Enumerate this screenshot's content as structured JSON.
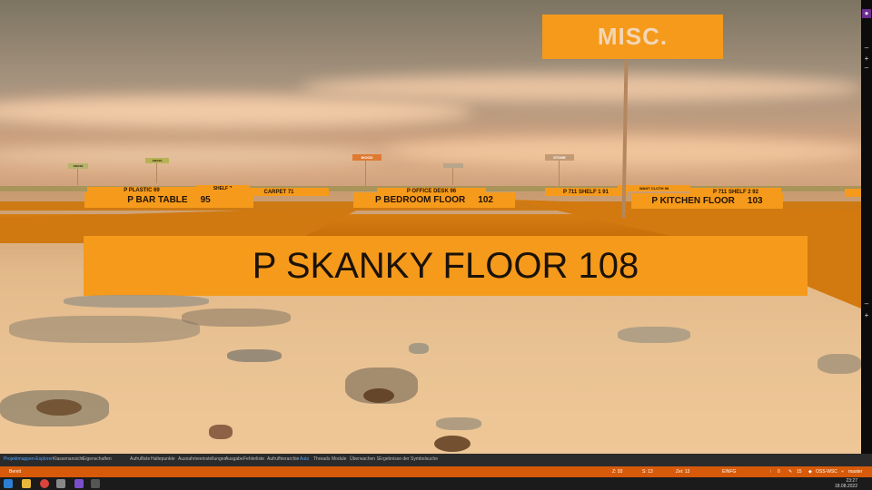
{
  "world": {
    "misc_sign": "MISC.",
    "main_sign": "P SKANKY FLOOR 108",
    "near_signs": [
      {
        "label": "P BAR TABLE",
        "number": "95"
      },
      {
        "label": "P BEDROOM FLOOR",
        "number": "102"
      },
      {
        "label": "P KITCHEN FLOOR",
        "number": "103"
      }
    ],
    "far_signs": [
      "P PLASTIC 69",
      "CARPET 71",
      "SHELF 2",
      "P OFFICE DESK 96",
      "P 711 SHELF 1 91",
      "P 711 SHELF 2 92",
      "WANT CLOTH 98",
      "WOOD",
      "STONE",
      "GRASS"
    ]
  },
  "tabs": [
    "Projektmappen-Explorer",
    "Klassenansicht",
    "Eigenschaften",
    "Aufrufliste",
    "Haltepunkte",
    "Ausnahmeeinstellungen",
    "Ausgabe",
    "Fehlerliste",
    "Aufrufhierarchie",
    "Auto",
    "Threads",
    "Module",
    "Überwachen 1",
    "Ergebnisse der Symbolsuche"
  ],
  "status": {
    "ready": "Bereit",
    "line": "Z: 93",
    "col": "S: 13",
    "char": "Zei: 13",
    "mode": "EINFG",
    "up": "0",
    "errors": "15",
    "branch": "OSS-WSC",
    "master": "master"
  },
  "clock": {
    "time": "23:27",
    "date": "18.08.2022"
  }
}
